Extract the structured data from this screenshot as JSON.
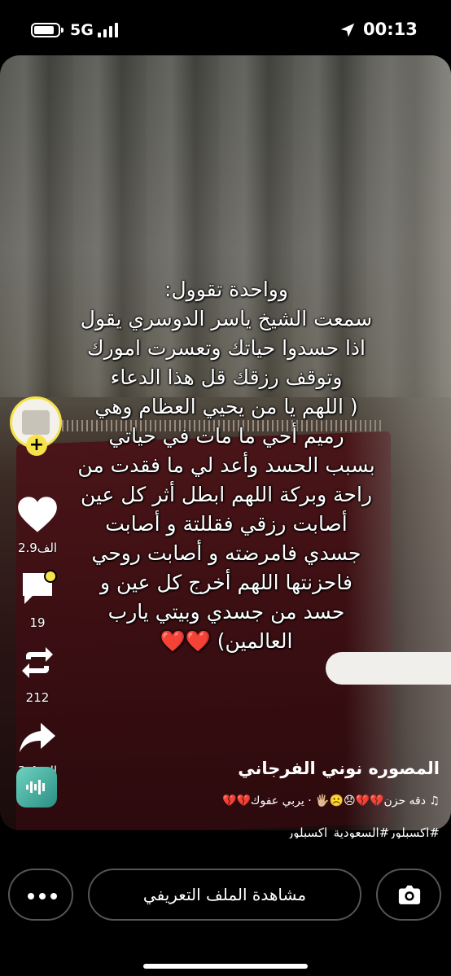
{
  "status_bar": {
    "network": "5G",
    "time": "00:13"
  },
  "post": {
    "text_lines": [
      "وواحدة تقوول:",
      "سمعت الشيخ ياسر الدوسري يقول",
      "اذا حسدوا حياتك وتعسرت امورك",
      "وتوقف رزقك قل هذا الدعاء",
      "( اللهم يا من يحيي العظام وهي",
      "رميم أحي ما مات في حياتي",
      "بسبب الحسد وأعد لي ما فقدت من",
      "راحة وبركة اللهم ابطل أثر كل عين",
      "أصابت رزقي فقللتة و أصابت",
      "جسدي فامرضته و أصابت روحي",
      "فاحزنتها اللهم أخرج كل عين و",
      "حسد من جسدي وبيتي يارب",
      "العالمين) ❤️❤️"
    ],
    "author": "المصوره نوني الفرجاني",
    "sound": "♫ دقه حزن💔💔😞☹️🖐🏼 · يربي عفوك💔💔",
    "hashtags": "#اكسبلور#السعودية_اكسبلور"
  },
  "actions": {
    "likes": "2.9الف",
    "comments": "19",
    "reposts": "212",
    "shares": "3.4الف"
  },
  "bottom_bar": {
    "view_profile_label": "مشاهدة الملف التعريفي"
  },
  "colors": {
    "accent_yellow": "#f6e24b",
    "background": "#000000"
  }
}
